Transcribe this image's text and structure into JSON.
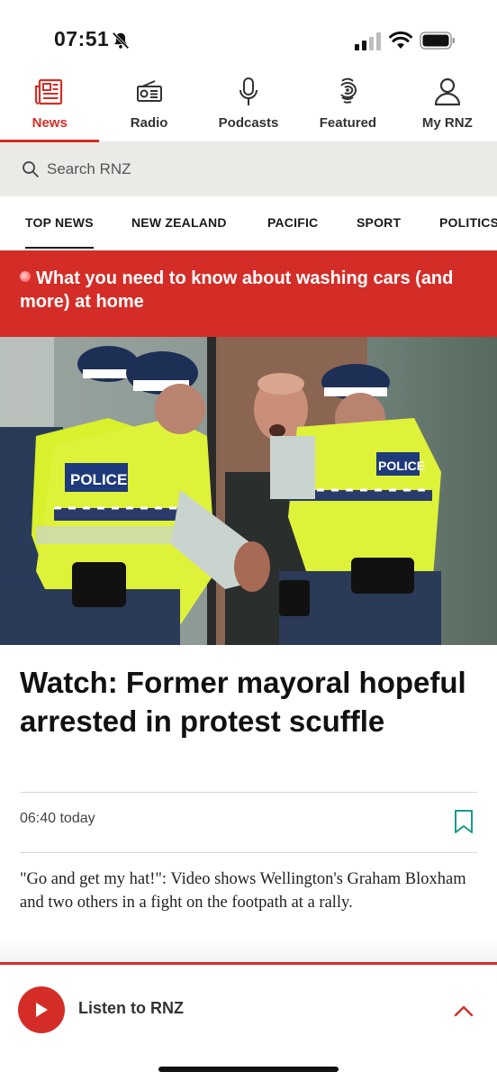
{
  "status_bar": {
    "time": "07:51"
  },
  "top_nav": {
    "items": [
      {
        "label": "News",
        "icon": "newspaper-icon",
        "active": true
      },
      {
        "label": "Radio",
        "icon": "radio-icon",
        "active": false
      },
      {
        "label": "Podcasts",
        "icon": "microphone-icon",
        "active": false
      },
      {
        "label": "Featured",
        "icon": "rnz-logo-icon",
        "active": false
      },
      {
        "label": "My RNZ",
        "icon": "user-icon",
        "active": false
      }
    ]
  },
  "search": {
    "placeholder": "Search RNZ"
  },
  "category_tabs": [
    "TOP NEWS",
    "NEW ZEALAND",
    "PACIFIC",
    "SPORT",
    "POLITICS"
  ],
  "breaking": {
    "text": "What you need to know about washing cars (and more) at home"
  },
  "article": {
    "headline": "Watch: Former mayoral hopeful arrested in protest scuffle",
    "time": "06:40 today",
    "summary": "\"Go and get my hat!\": Video shows Wellington's Graham Bloxham and two others in a fight on the footpath at a rally."
  },
  "player": {
    "label": "Listen to RNZ"
  },
  "colors": {
    "accent": "#d42d27",
    "search_bg": "#ebeae7",
    "police_vest": "#d9f02c",
    "bookmark": "#1a9a8a"
  }
}
